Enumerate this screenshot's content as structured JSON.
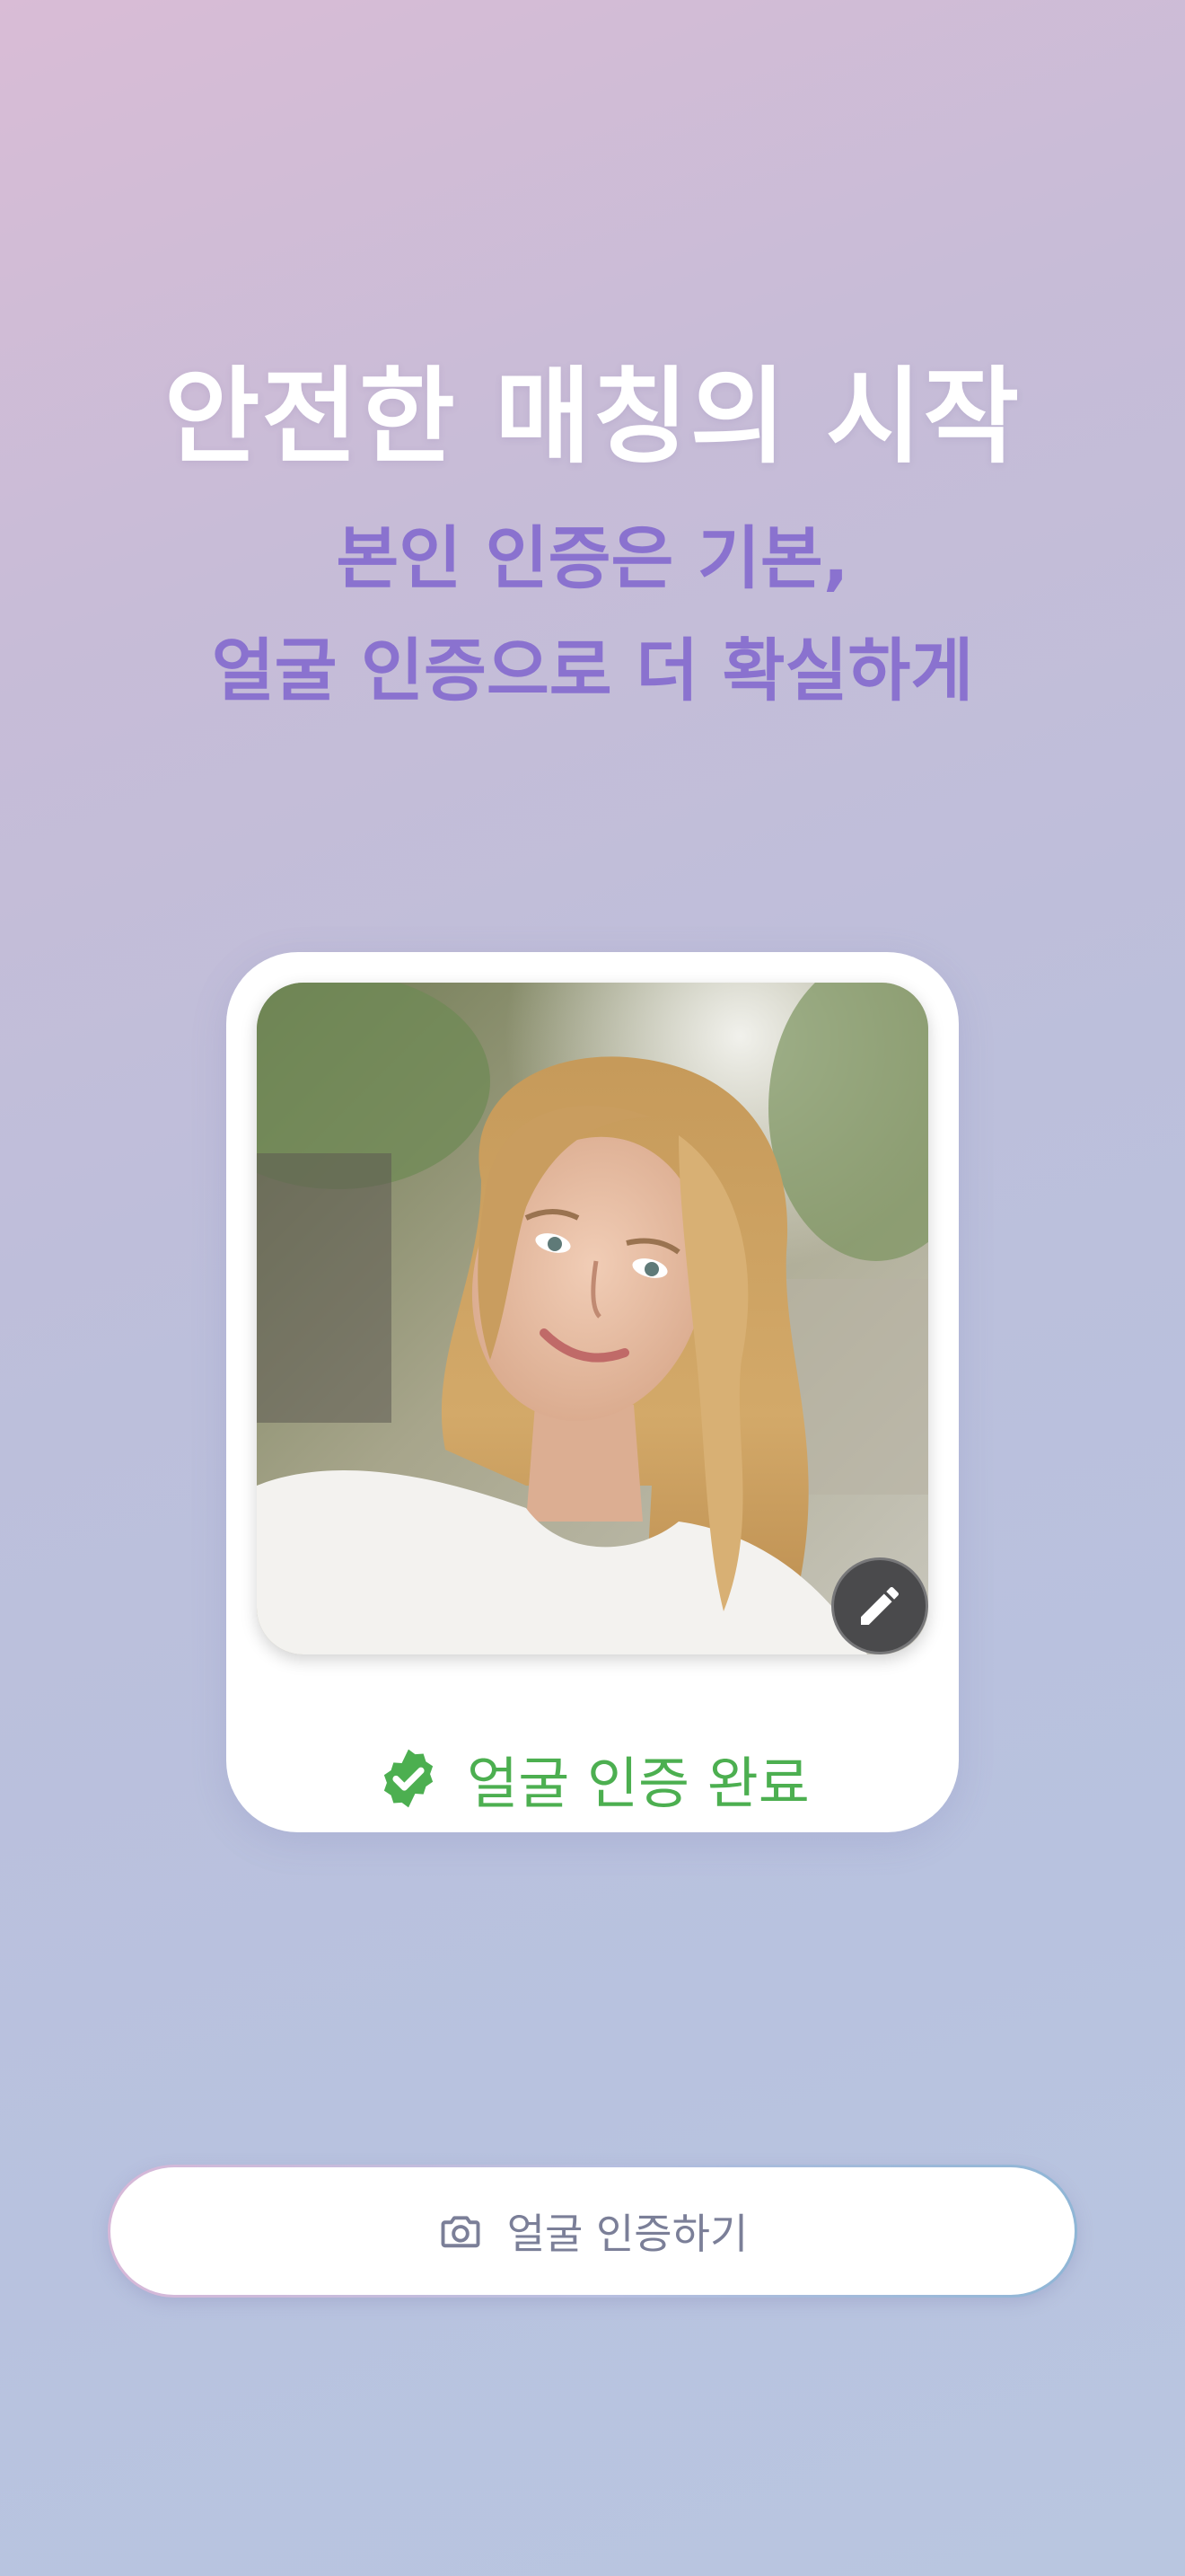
{
  "header": {
    "title": "안전한 매칭의 시작",
    "subtitle_line1": "본인 인증은 기본,",
    "subtitle_line2": "얼굴 인증으로 더 확실하게"
  },
  "profile_card": {
    "photo_alt": "프로필 사진",
    "edit_icon": "pencil-icon",
    "status_icon": "verified-badge-icon",
    "status_label": "얼굴 인증 완료",
    "status_color": "#4caf50"
  },
  "cta": {
    "icon": "camera-icon",
    "label": "얼굴 인증하기"
  },
  "colors": {
    "accent_purple": "#8a72cf",
    "success_green": "#4caf50",
    "edit_button_bg": "#4a4a4c"
  }
}
